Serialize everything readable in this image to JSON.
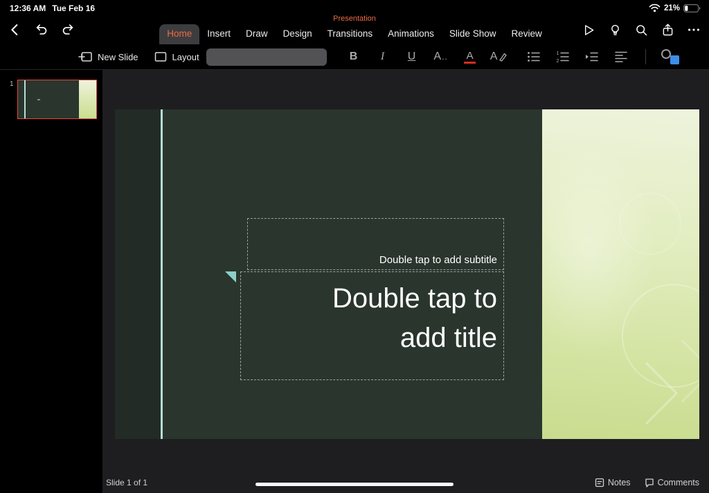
{
  "status_bar": {
    "time": "12:36 AM",
    "date": "Tue Feb 16",
    "battery_percent": "21%"
  },
  "header": {
    "doc_title": "Presentation",
    "active_tab": "Home",
    "tabs": [
      {
        "label": "Home"
      },
      {
        "label": "Insert"
      },
      {
        "label": "Draw"
      },
      {
        "label": "Design"
      },
      {
        "label": "Transitions"
      },
      {
        "label": "Animations"
      },
      {
        "label": "Slide Show"
      },
      {
        "label": "Review"
      }
    ]
  },
  "toolbar": {
    "new_slide_label": "New Slide",
    "layout_label": "Layout",
    "font_field_value": "",
    "bold": "B",
    "italic": "I",
    "underline": "U",
    "font_size_letter": "A",
    "font_size_dots": "..",
    "font_color_letter": "A",
    "highlight_letter": "A"
  },
  "thumbnails": {
    "slide1_number": "1",
    "selected": "1"
  },
  "slide": {
    "subtitle_placeholder": "Double tap to add subtitle",
    "title_line1": "Double tap to",
    "title_line2": "add title"
  },
  "footer": {
    "slide_counter": "Slide 1 of 1",
    "notes_label": "Notes",
    "comments_label": "Comments"
  },
  "icons": {
    "back": "chevron-left",
    "undo": "undo-arrow",
    "redo": "redo-arrow",
    "play": "slideshow-play",
    "ideas": "lightbulb",
    "search": "magnifier",
    "share": "share-box-arrow",
    "more": "ellipsis",
    "wifi": "wifi-arcs",
    "battery": "battery-21"
  },
  "colors": {
    "accent_orange": "#ED6C47",
    "selected_thumb_red": "#E8473F",
    "font_color_red": "#D92B21",
    "shape_fill_blue": "#3E8DE8",
    "slide_background": "#2A352E",
    "slide_accent_line": "#B5DED6",
    "right_panel_green_top": "#EEF3DC",
    "right_panel_green_bottom": "#C9DC8E"
  }
}
